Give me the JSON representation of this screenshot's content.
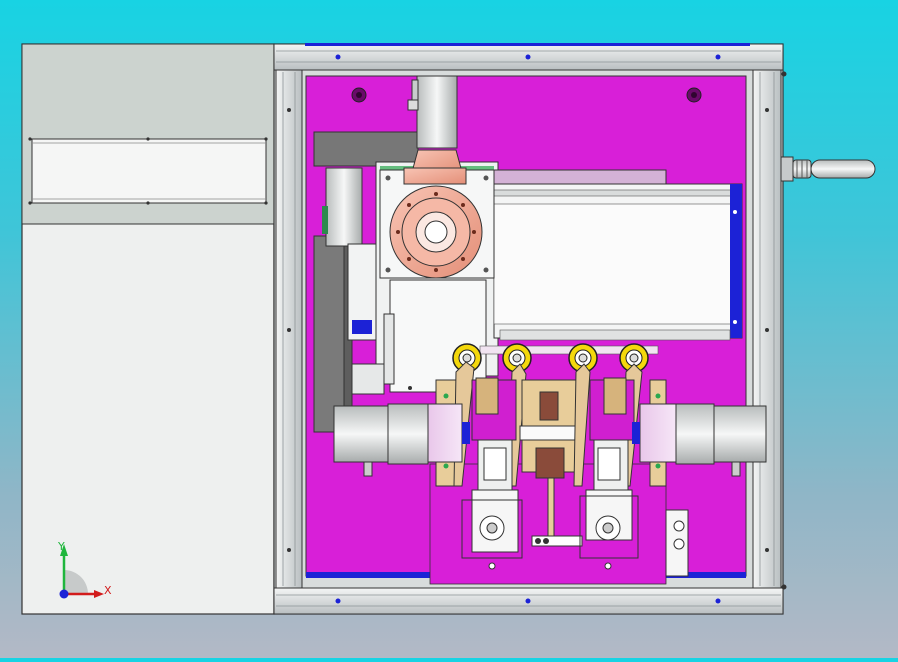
{
  "viewport": {
    "background_top": "#18d3e3",
    "background_bottom": "#b3b9c6"
  },
  "triad": {
    "x_label": "X",
    "y_label": "Y"
  },
  "colors": {
    "panel_gray": "#ccd3cf",
    "panel_white": "#eef0ef",
    "frame_gray": "#d8dcdc",
    "plate_magenta": "#d81fd8",
    "accent_blue": "#1c22d6",
    "bearing_yellow": "#f4d80c",
    "motor_copper": "#f2a48e",
    "gold": "#d6b37c"
  }
}
